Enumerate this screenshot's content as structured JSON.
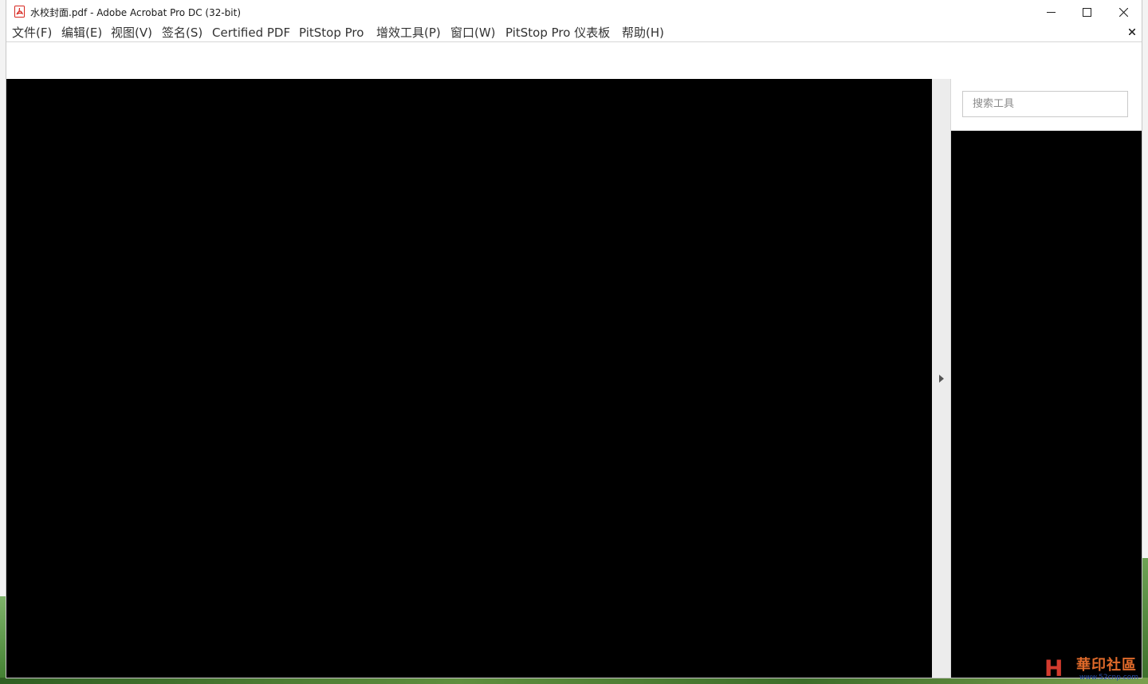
{
  "window": {
    "title": "水校封面.pdf - Adobe Acrobat Pro DC (32-bit)"
  },
  "menubar": {
    "items": [
      {
        "label": "文件(F)"
      },
      {
        "label": "编辑(E)"
      },
      {
        "label": "视图(V)"
      },
      {
        "label": "签名(S)"
      },
      {
        "label": "Certified PDF"
      },
      {
        "label": "PitStop Pro"
      },
      {
        "label": "增效工具(P)"
      },
      {
        "label": "窗口(W)"
      },
      {
        "label": "PitStop Pro 仪表板"
      },
      {
        "label": "帮助(H)"
      }
    ]
  },
  "tools_pane": {
    "search_placeholder": "搜索工具"
  },
  "watermark": {
    "text": "華印社區",
    "url": "www.52cnp.com"
  },
  "colors": {
    "document_bg": "#000000",
    "acrobat_red": "#d7261e",
    "pane_bg": "#ececec"
  }
}
